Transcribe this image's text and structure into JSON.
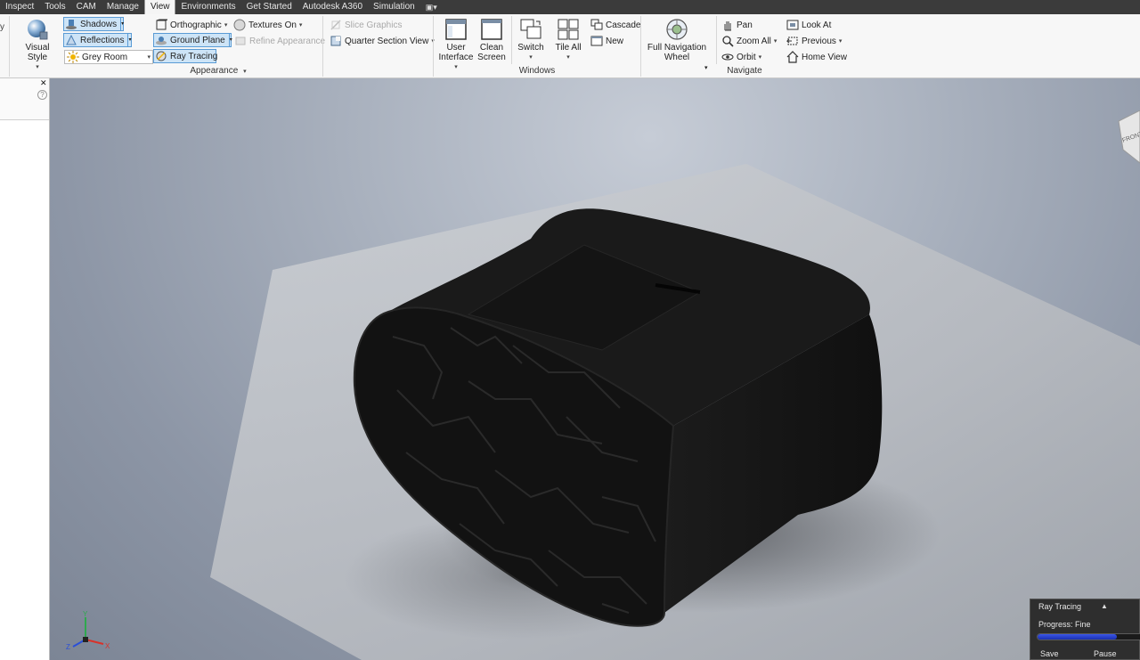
{
  "tabs": [
    "Inspect",
    "Tools",
    "CAM",
    "Manage",
    "View",
    "Environments",
    "Get Started",
    "Autodesk A360",
    "Simulation"
  ],
  "active_tab": "View",
  "tab_extra": "▾",
  "ribbon": {
    "left_cut_label": "y",
    "appearance": {
      "visual_style_label": "Visual Style",
      "shadows_label": "Shadows",
      "reflections_label": "Reflections",
      "grey_room_label": "Grey Room",
      "orthographic_label": "Orthographic",
      "ground_plane_label": "Ground Plane",
      "ray_tracing_label": "Ray Tracing",
      "textures_on_label": "Textures On",
      "refine_appearance_label": "Refine Appearance",
      "slice_graphics_label": "Slice Graphics",
      "quarter_section_label": "Quarter Section View",
      "panel_title": "Appearance"
    },
    "windows": {
      "user_interface_line1": "User",
      "user_interface_line2": "Interface",
      "clean_screen_line1": "Clean",
      "clean_screen_line2": "Screen",
      "switch_label": "Switch",
      "tile_all_label": "Tile All",
      "cascade_label": "Cascade",
      "new_label": "New",
      "panel_title": "Windows"
    },
    "navigate": {
      "full_nav_wheel_line1": "Full Navigation",
      "full_nav_wheel_line2": "Wheel",
      "pan_label": "Pan",
      "zoom_all_label": "Zoom All",
      "orbit_label": "Orbit",
      "look_at_label": "Look At",
      "previous_label": "Previous",
      "home_view_label": "Home View",
      "panel_title": "Navigate"
    }
  },
  "browser": {
    "close_glyph": "✕",
    "help_glyph": "?"
  },
  "viewcube_face": "FRONT",
  "axis_labels": {
    "x": "X",
    "y": "Y",
    "z": "Z"
  },
  "ray_tracing_panel": {
    "title": "Ray Tracing",
    "collapse_glyph": "▲",
    "progress_label": "Progress: Fine",
    "progress_fraction": 0.75,
    "save_label": "Save",
    "pause_label": "Pause"
  },
  "colors": {
    "accent": "#5a9bd5",
    "progress": "#2a44d8",
    "model": "#151515",
    "tabbar": "#3b3b3b"
  }
}
